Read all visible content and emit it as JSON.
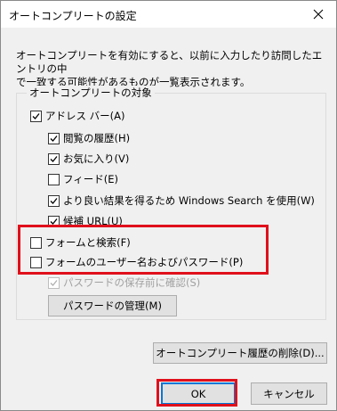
{
  "dialog": {
    "title": "オートコンプリートの設定",
    "description_line1": "オートコンプリートを有効にすると、以前に入力したり訪問したエントリの中",
    "description_line2": "で一致する可能性があるものが一覧表示されます。"
  },
  "group": {
    "label": "オートコンプリートの対象",
    "items": [
      {
        "label": "アドレス バー(A)",
        "checked": true
      },
      {
        "label": "閲覧の履歴(H)",
        "checked": true
      },
      {
        "label": "お気に入り(V)",
        "checked": true
      },
      {
        "label": "フィード(E)",
        "checked": false
      },
      {
        "label": "より良い結果を得るため Windows Search を使用(W)",
        "checked": true
      },
      {
        "label": "候補 URL(U)",
        "checked": true
      },
      {
        "label": "フォームと検索(F)",
        "checked": false
      },
      {
        "label": "フォームのユーザー名およびパスワード(P)",
        "checked": false
      },
      {
        "label": "パスワードの保存前に確認(S)",
        "checked": true,
        "disabled": true
      }
    ],
    "manage_passwords_button": "パスワードの管理(M)"
  },
  "buttons": {
    "delete_history": "オートコンプリート履歴の削除(D)...",
    "ok": "OK",
    "cancel": "キャンセル"
  },
  "colors": {
    "highlight": "#e0101c",
    "default_button_border": "#0078d7"
  }
}
